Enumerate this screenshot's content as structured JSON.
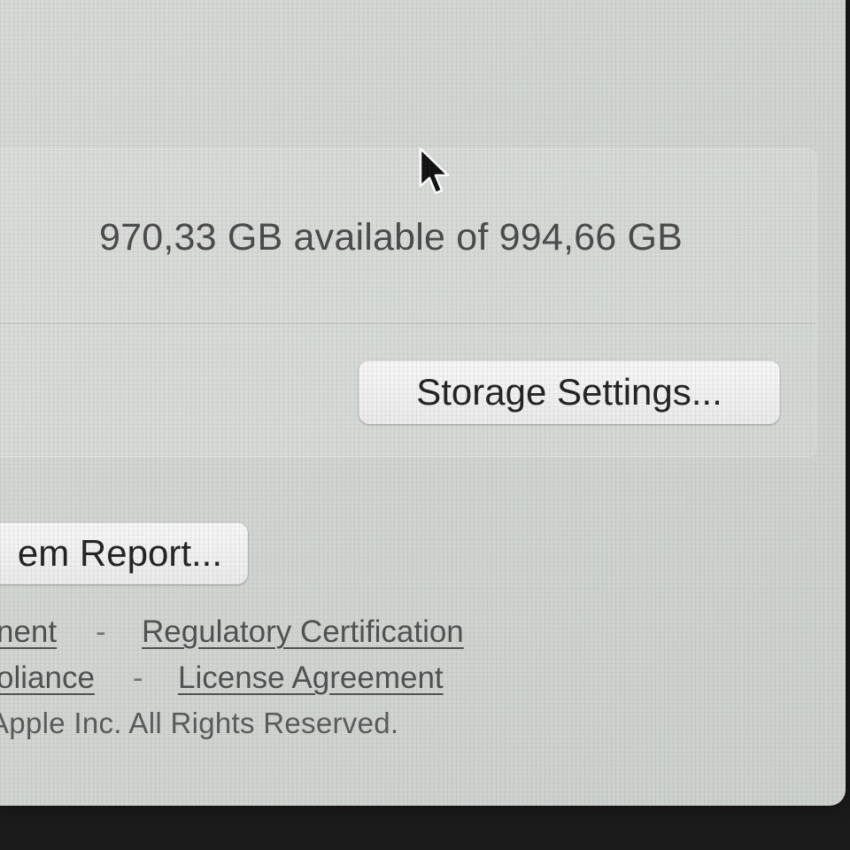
{
  "storage": {
    "summary": "970,33 GB available of 994,66 GB",
    "settings_button": "Storage Settings..."
  },
  "system_report_button": "em Report...",
  "footer": {
    "link_agreement_partial": "nent",
    "separator1": "-",
    "link_regulatory": "Regulatory Certification",
    "link_compliance_partial": "oliance",
    "separator2": "-",
    "link_license": "License Agreement",
    "copyright": "Apple Inc. All Rights Reserved."
  },
  "icons": {
    "pointer": "arrow-cursor-icon"
  },
  "colors": {
    "window_background": "#d3d7d3",
    "button_background": "#f2f2f2",
    "text": "#4a4a4a"
  }
}
